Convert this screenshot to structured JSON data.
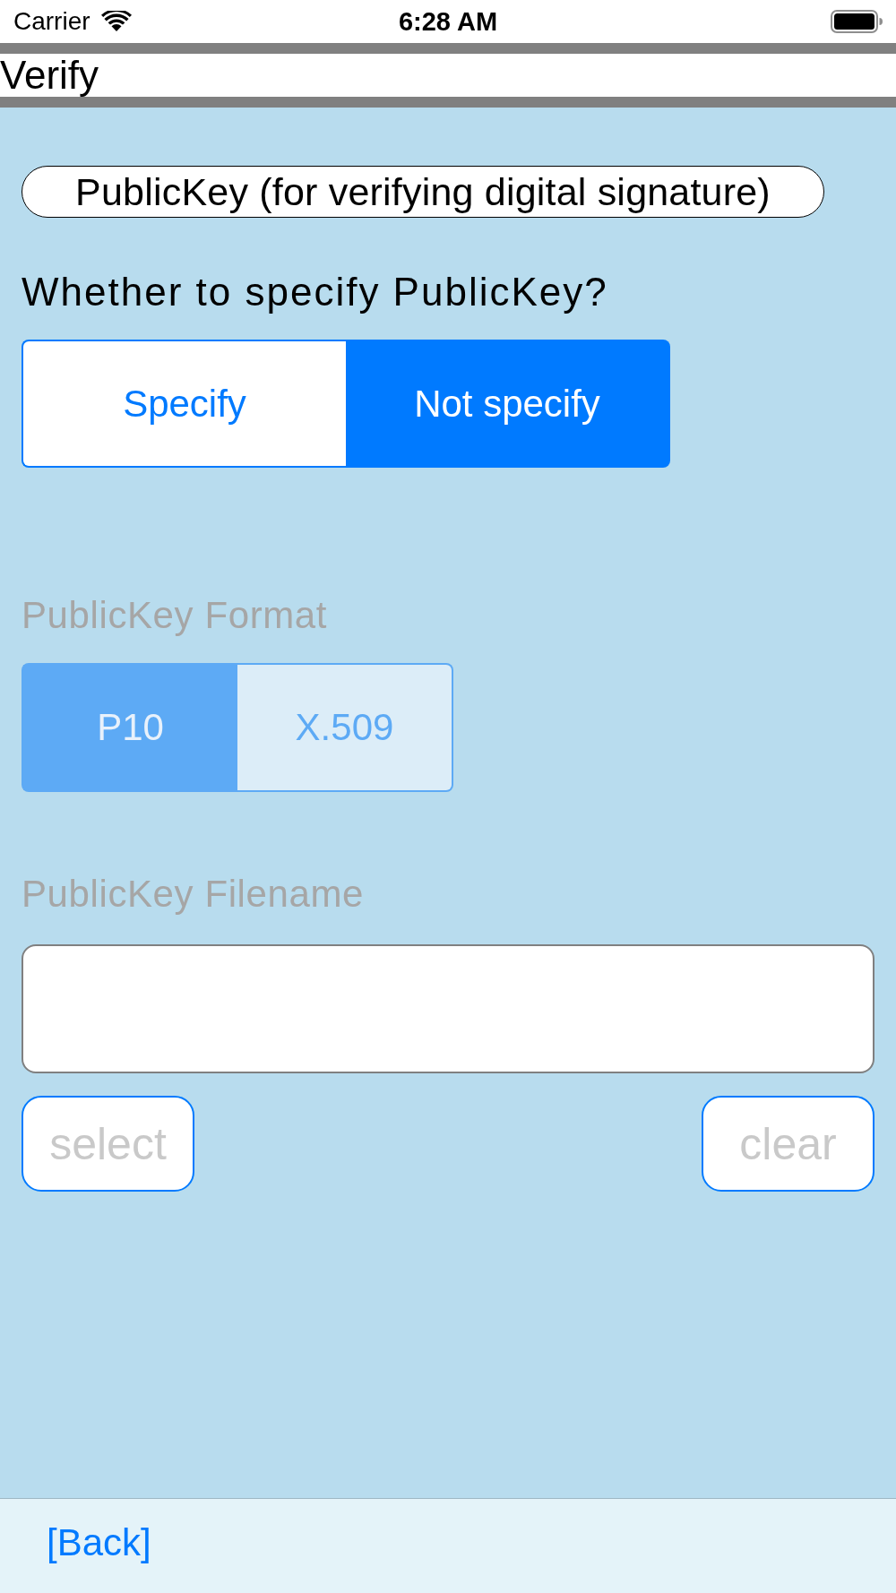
{
  "status_bar": {
    "carrier": "Carrier",
    "time": "6:28 AM"
  },
  "nav_bar": {
    "title": "Verify"
  },
  "section_title": "PublicKey (for verifying digital signature)",
  "specify": {
    "label": "Whether to specify PublicKey?",
    "disabled": false,
    "options": [
      {
        "label": "Specify",
        "selected": false
      },
      {
        "label": "Not specify",
        "selected": true
      }
    ]
  },
  "format": {
    "label": "PublicKey Format",
    "disabled": true,
    "options": [
      {
        "label": "P10",
        "selected": true
      },
      {
        "label": "X.509",
        "selected": false
      }
    ]
  },
  "filename": {
    "label": "PublicKey Filename",
    "disabled": true,
    "buttons": [
      {
        "label": "select",
        "disabled": true
      },
      {
        "label": "clear",
        "disabled": true
      }
    ]
  },
  "footer": {
    "back_link": "[Back]"
  }
}
